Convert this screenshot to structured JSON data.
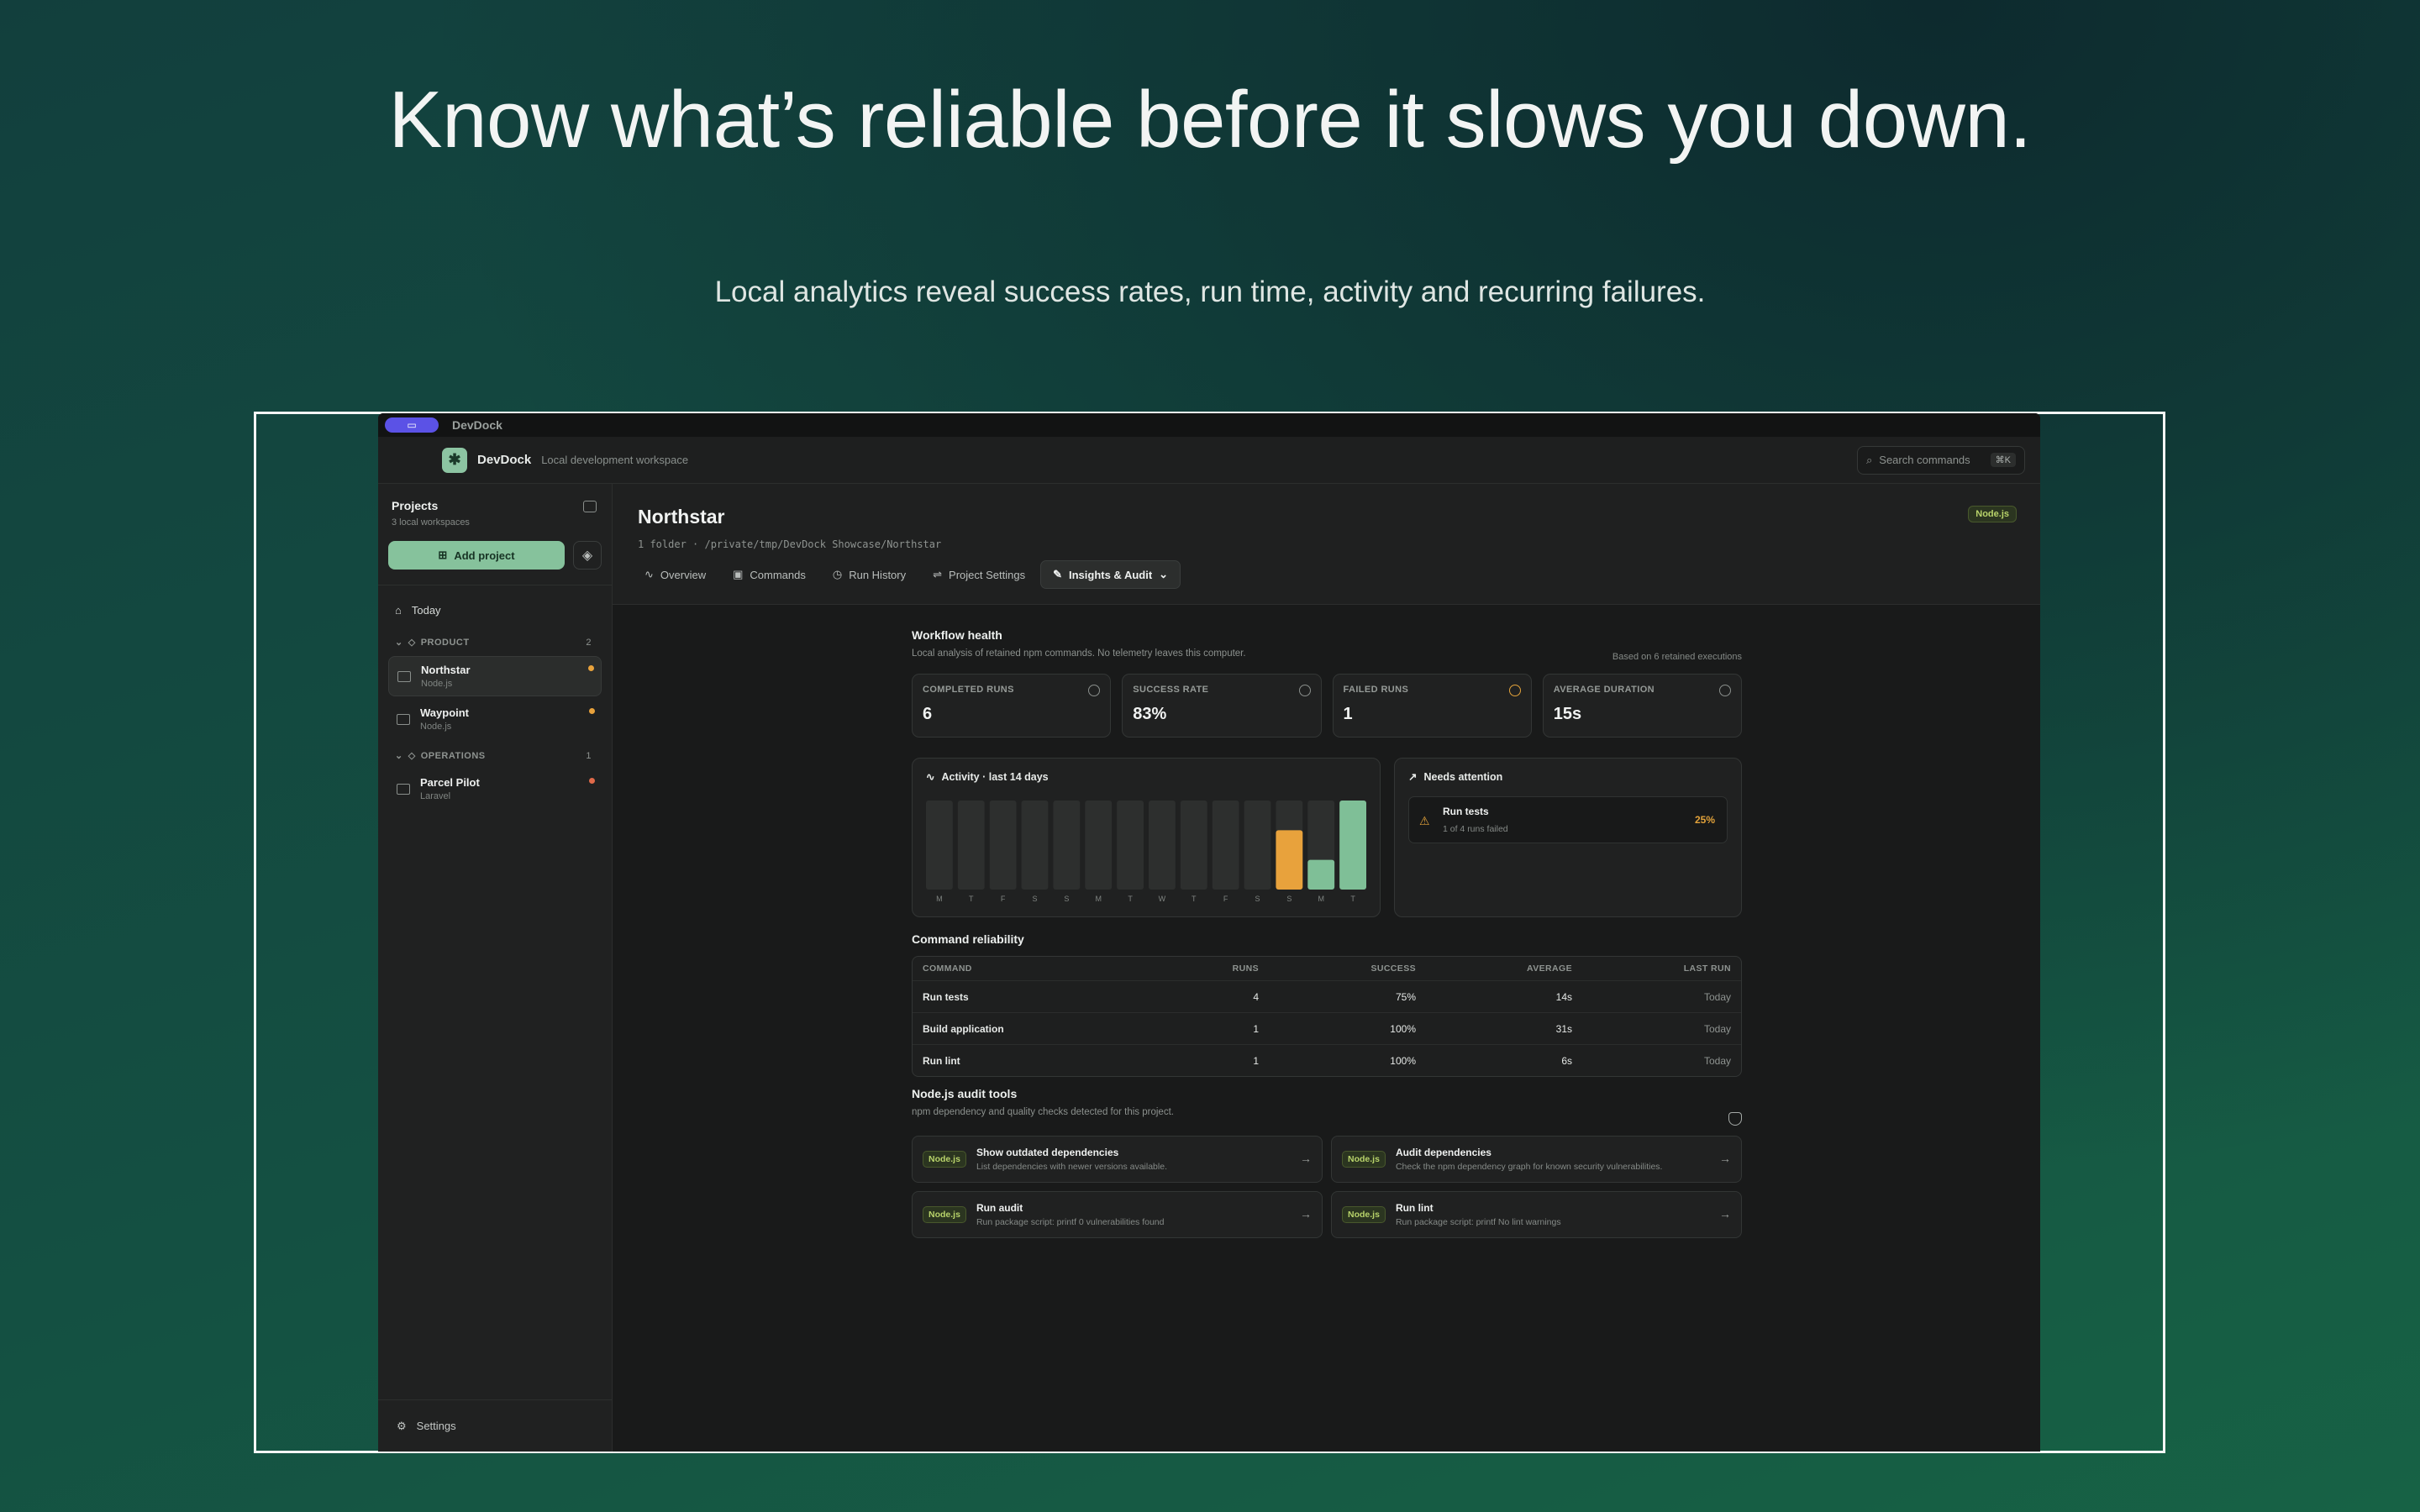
{
  "hero": {
    "headline": "Know what’s reliable before it slows you down.",
    "subline": "Local analytics reveal success rates, run time, activity and recurring failures."
  },
  "window": {
    "title": "DevDock"
  },
  "appbar": {
    "name": "DevDock",
    "subtitle": "Local development workspace",
    "search_placeholder": "Search commands",
    "search_shortcut": "⌘K"
  },
  "sidebar": {
    "title": "Projects",
    "subtitle": "3 local workspaces",
    "add_label": "Add project",
    "today_label": "Today",
    "groups": [
      {
        "name": "PRODUCT",
        "count": "2"
      },
      {
        "name": "OPERATIONS",
        "count": "1"
      }
    ],
    "projects": [
      {
        "name": "Northstar",
        "type": "Node.js",
        "dot": "#e8a23c"
      },
      {
        "name": "Waypoint",
        "type": "Node.js",
        "dot": "#e8a23c"
      },
      {
        "name": "Parcel Pilot",
        "type": "Laravel",
        "dot": "#e06a4a"
      }
    ],
    "settings_label": "Settings"
  },
  "project": {
    "title": "Northstar",
    "path": "1 folder · /private/tmp/DevDock Showcase/Northstar",
    "badge": "Node.js"
  },
  "tabs": [
    "Overview",
    "Commands",
    "Run History",
    "Project Settings",
    "Insights & Audit"
  ],
  "health": {
    "title": "Workflow health",
    "subtitle": "Local analysis of retained npm commands. No telemetry leaves this computer.",
    "based_on": "Based on 6 retained executions",
    "stats": [
      {
        "label": "COMPLETED RUNS",
        "value": "6"
      },
      {
        "label": "SUCCESS RATE",
        "value": "83%"
      },
      {
        "label": "FAILED RUNS",
        "value": "1"
      },
      {
        "label": "AVERAGE DURATION",
        "value": "15s"
      }
    ]
  },
  "activity": {
    "title": "Activity · last 14 days"
  },
  "chart_data": {
    "type": "bar",
    "categories": [
      "M",
      "T",
      "F",
      "S",
      "S",
      "M",
      "T",
      "W",
      "T",
      "F",
      "S",
      "S",
      "M",
      "T"
    ],
    "values": [
      0,
      0,
      0,
      0,
      0,
      0,
      0,
      0,
      0,
      0,
      0,
      2,
      1,
      3
    ],
    "colors": {
      "empty": "#2d2f2e",
      "mixed": "#e8a23c",
      "success": "#7fbf97"
    },
    "bar_status": [
      "empty",
      "empty",
      "empty",
      "empty",
      "empty",
      "empty",
      "empty",
      "empty",
      "empty",
      "empty",
      "empty",
      "mixed",
      "success",
      "success"
    ],
    "title": "",
    "xlabel": "",
    "ylabel": "",
    "ylim": [
      0,
      3
    ]
  },
  "attention": {
    "title": "Needs attention",
    "item_name": "Run tests",
    "item_sub": "1 of 4 runs failed",
    "item_pct": "25%"
  },
  "reliability": {
    "title": "Command reliability",
    "headers": [
      "COMMAND",
      "RUNS",
      "SUCCESS",
      "AVERAGE",
      "LAST RUN"
    ],
    "rows": [
      [
        "Run tests",
        "4",
        "75%",
        "14s",
        "Today"
      ],
      [
        "Build application",
        "1",
        "100%",
        "31s",
        "Today"
      ],
      [
        "Run lint",
        "1",
        "100%",
        "6s",
        "Today"
      ]
    ]
  },
  "audit": {
    "title": "Node.js audit tools",
    "subtitle": "npm dependency and quality checks detected for this project.",
    "items": [
      {
        "badge": "Node.js",
        "name": "Show outdated dependencies",
        "sub": "List dependencies with newer versions available."
      },
      {
        "badge": "Node.js",
        "name": "Audit dependencies",
        "sub": "Check the npm dependency graph for known security vulnerabilities."
      },
      {
        "badge": "Node.js",
        "name": "Run audit",
        "sub": "Run package script: printf 0 vulnerabilities found"
      },
      {
        "badge": "Node.js",
        "name": "Run lint",
        "sub": "Run package script: printf No lint warnings"
      }
    ]
  }
}
